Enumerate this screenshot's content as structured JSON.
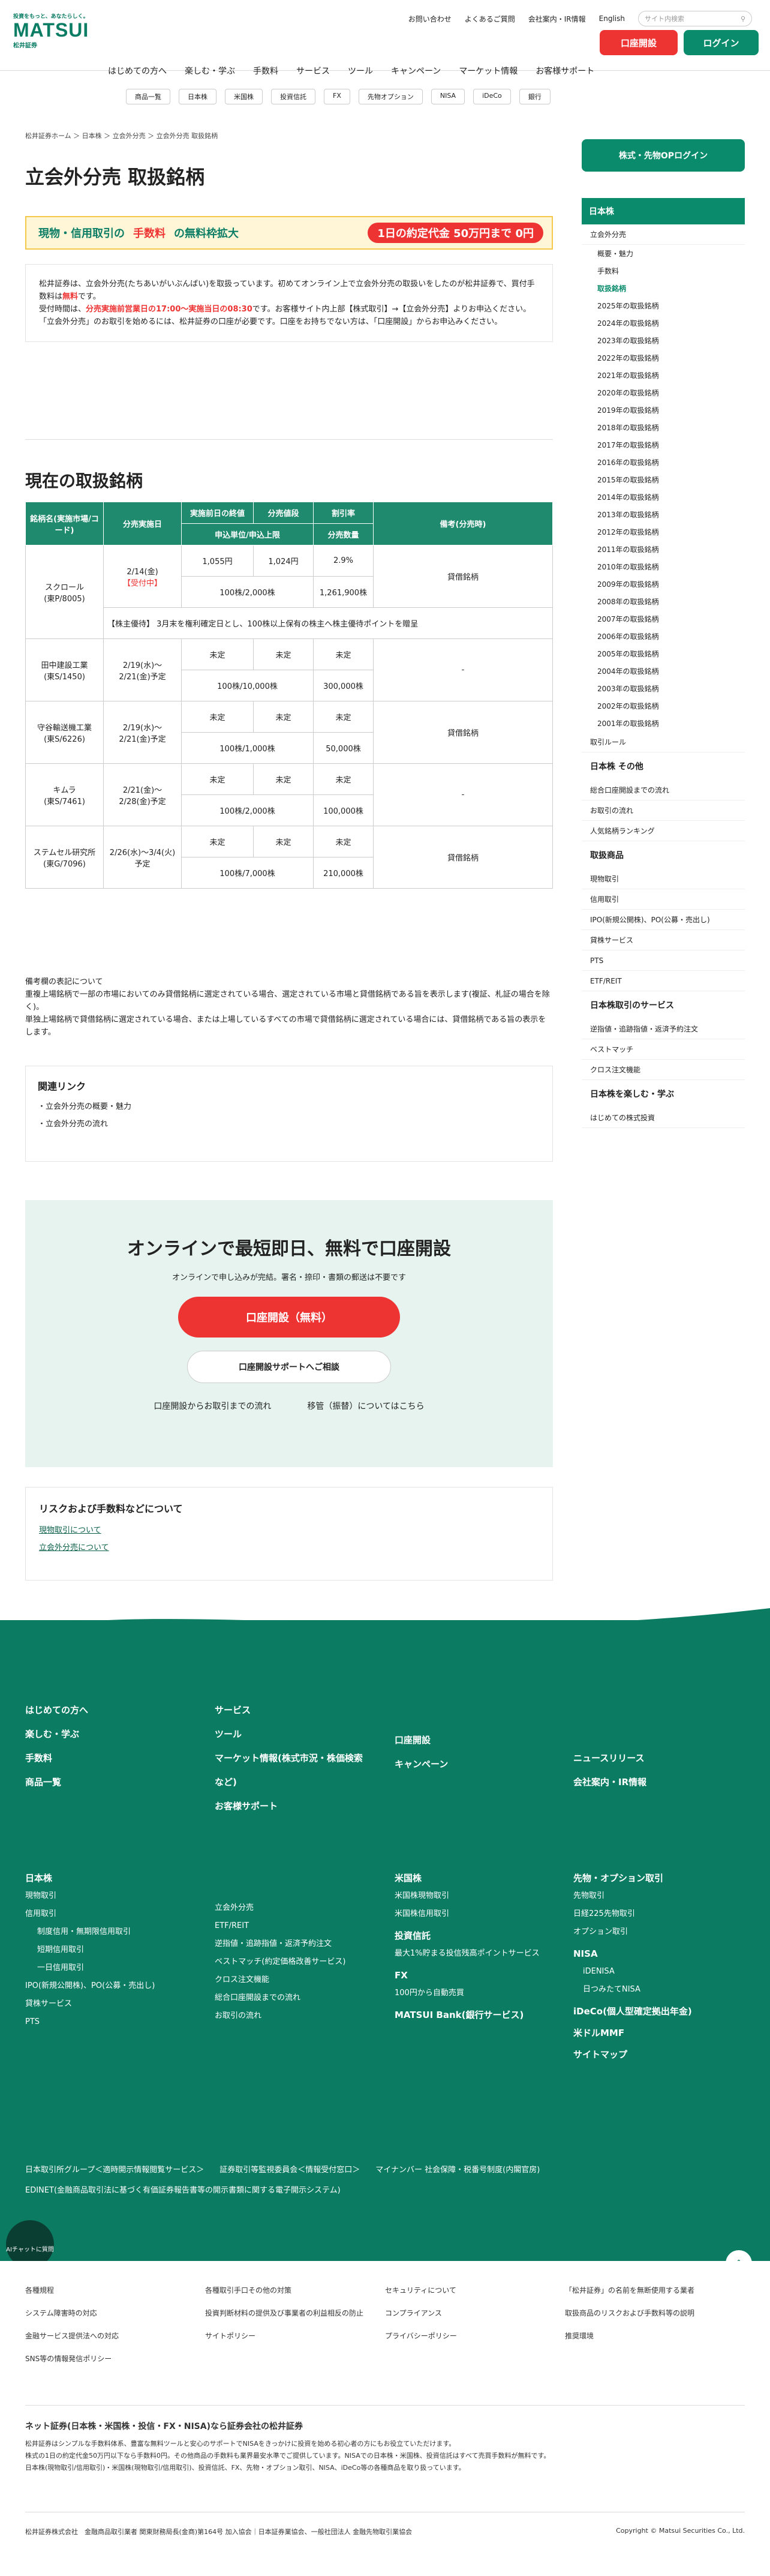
{
  "header": {
    "tagline": "投資をもっと、あなたらしく。",
    "logo": "MATSUI",
    "logo_sub": "松井証券",
    "links": [
      "お問い合わせ",
      "よくあるご質問",
      "会社案内・IR情報",
      "English"
    ],
    "search_placeholder": "サイト内検索",
    "open_account": "口座開設",
    "login": "ログイン"
  },
  "nav": {
    "items": [
      "はじめての方へ",
      "楽しむ・学ぶ",
      "手数料",
      "サービス",
      "ツール",
      "キャンペーン",
      "マーケット情報",
      "お客様サポート"
    ],
    "sub": [
      "商品一覧",
      "日本株",
      "米国株",
      "投資信託",
      "FX",
      "先物オプション",
      "NISA",
      "iDeCo",
      "銀行"
    ]
  },
  "breadcrumb": "松井証券ホーム ＞ 日本株 ＞ 立会外分売 ＞ 立会外分売 取扱銘柄",
  "page_title": "立会外分売 取扱銘柄",
  "banner": {
    "text1": "現物・信用取引の",
    "text2": "手数料",
    "text3": "の無料枠拡大",
    "text4": "1日の約定代金",
    "text5": "50万円まで",
    "text6": "0円"
  },
  "intro": {
    "p1": "松井証券は、立会外分売(たちあいがいぶんばい)を取扱っています。初めてオンライン上で立会外分売の取扱いをしたのが松井証券で、買付手数料は",
    "free": "無料",
    "p1b": "です。",
    "p2": "受付時間は、",
    "hours": "分売実施前営業日の17:00〜実施当日の08:30",
    "p2b": "です。お客様サイト内上部【株式取引】→【立会外分売】よりお申込ください。",
    "p3": "「立会外分売」のお取引を始めるには、松井証券の口座が必要です。口座をお持ちでない方は、「口座開設」からお申込みください。"
  },
  "section_title": "現在の取扱銘柄",
  "table": {
    "headers": [
      "銘柄名(実施市場/コード)",
      "分売実施日",
      "実施前日の終値",
      "分売値段",
      "割引率",
      "備考(分売時)"
    ],
    "sub_headers": [
      "申込単位/申込上限",
      "分売数量"
    ],
    "rows": [
      {
        "name": "スクロール",
        "code": "(東P/8005)",
        "date": "2/14(金)",
        "status": "【受付中】",
        "close": "1,055円",
        "price": "1,024円",
        "rate": "2.9%",
        "unit": "100株/2,000株",
        "qty": "1,261,900株",
        "note": "貸借銘柄",
        "extra": "【株主優待】 3月末を権利確定日とし、100株以上保有の株主へ株主優待ポイントを贈呈"
      },
      {
        "name": "田中建設工業",
        "code": "(東S/1450)",
        "date": "2/19(水)〜2/21(金)予定",
        "close": "未定",
        "price": "未定",
        "rate": "未定",
        "unit": "100株/10,000株",
        "qty": "300,000株",
        "note": "-"
      },
      {
        "name": "守谷輸送機工業",
        "code": "(東S/6226)",
        "date": "2/19(水)〜2/21(金)予定",
        "close": "未定",
        "price": "未定",
        "rate": "未定",
        "unit": "100株/1,000株",
        "qty": "50,000株",
        "note": "貸借銘柄"
      },
      {
        "name": "キムラ",
        "code": "(東S/7461)",
        "date": "2/21(金)〜2/28(金)予定",
        "close": "未定",
        "price": "未定",
        "rate": "未定",
        "unit": "100株/2,000株",
        "qty": "100,000株",
        "note": "-"
      },
      {
        "name": "ステムセル研究所",
        "code": "(東G/7096)",
        "date": "2/26(水)〜3/4(火)予定",
        "close": "未定",
        "price": "未定",
        "rate": "未定",
        "unit": "100株/7,000株",
        "qty": "210,000株",
        "note": "貸借銘柄"
      }
    ]
  },
  "notes": [
    "備考欄の表記について",
    "重複上場銘柄で一部の市場においてのみ貸借銘柄に選定されている場合、選定されている市場と貸借銘柄である旨を表示します(複証、札証の場合を除く)。",
    "単独上場銘柄で貸借銘柄に選定されている場合、または上場しているすべての市場で貸借銘柄に選定されている場合には、貸借銘柄である旨の表示をします。"
  ],
  "related": {
    "title": "関連リンク",
    "links": [
      "立会外分売の概要・魅力",
      "立会外分売の流れ"
    ]
  },
  "cta": {
    "title": "オンラインで最短即日、無料で口座開設",
    "desc": "オンラインで申し込みが完結。署名・捺印・書類の郵送は不要です",
    "primary": "口座開設（無料）",
    "secondary": "口座開設サポートへご相談",
    "link1": "口座開設からお取引までの流れ",
    "link2": "移管（振替）についてはこちら"
  },
  "risk": {
    "title": "リスクおよび手数料などについて",
    "links": [
      "現物取引について",
      "立会外分売について"
    ]
  },
  "sidebar": {
    "login": "株式・先物OPログイン",
    "head": "日本株",
    "items": [
      "立会外分売",
      "概要・魅力",
      "手数料",
      "取扱銘柄"
    ],
    "years": [
      "2025年の取扱銘柄",
      "2024年の取扱銘柄",
      "2023年の取扱銘柄",
      "2022年の取扱銘柄",
      "2021年の取扱銘柄",
      "2020年の取扱銘柄",
      "2019年の取扱銘柄",
      "2018年の取扱銘柄",
      "2017年の取扱銘柄",
      "2016年の取扱銘柄",
      "2015年の取扱銘柄",
      "2014年の取扱銘柄",
      "2013年の取扱銘柄",
      "2012年の取扱銘柄",
      "2011年の取扱銘柄",
      "2010年の取扱銘柄",
      "2009年の取扱銘柄",
      "2008年の取扱銘柄",
      "2007年の取扱銘柄",
      "2006年の取扱銘柄",
      "2005年の取扱銘柄",
      "2004年の取扱銘柄",
      "2003年の取扱銘柄",
      "2002年の取扱銘柄",
      "2001年の取扱銘柄"
    ],
    "rule": "取引ルール",
    "other_head": "日本株 その他",
    "other": [
      "総合口座開設までの流れ",
      "お取引の流れ",
      "人気銘柄ランキング"
    ],
    "products_head": "取扱商品",
    "products": [
      "現物取引",
      "信用取引",
      "IPO(新規公開株)、PO(公募・売出し)",
      "貸株サービス",
      "PTS",
      "ETF/REIT"
    ],
    "services_head": "日本株取引のサービス",
    "services": [
      "逆指値・追跡指値・返済予約注文",
      "ベストマッチ",
      "クロス注文機能"
    ],
    "fun_head": "日本株を楽しむ・学ぶ",
    "fun": [
      "はじめての株式投資"
    ]
  },
  "footer": {
    "col1": [
      "はじめての方へ",
      "楽しむ・学ぶ",
      "手数料",
      "商品一覧"
    ],
    "col2": [
      "サービス",
      "ツール",
      "マーケット情報(株式市況・株価検索など)",
      "お客様サポート"
    ],
    "col3": [
      "口座開設",
      "キャンペーン"
    ],
    "col4": [
      "ニュースリリース",
      "会社案内・IR情報"
    ],
    "jp_head": "日本株",
    "jp": [
      "現物取引",
      "信用取引",
      "制度信用・無期限信用取引",
      "短期信用取引",
      "一日信用取引",
      "IPO(新規公開株)、PO(公募・売出し)",
      "貸株サービス",
      "PTS"
    ],
    "jp2": [
      "立会外分売",
      "ETF/REIT",
      "逆指値・追跡指値・返済予約注文",
      "ベストマッチ(約定価格改善サービス)",
      "クロス注文機能",
      "総合口座開設までの流れ",
      "お取引の流れ"
    ],
    "us_head": "米国株",
    "us": [
      "米国株現物取引",
      "米国株信用取引"
    ],
    "fund_head": "投資信託",
    "fund": [
      "最大1%貯まる投信残高ポイントサービス"
    ],
    "fx_head": "FX",
    "fx": [
      "100円から自動売買"
    ],
    "bank": "MATSUI Bank(銀行サービス)",
    "fut_head": "先物・オプション取引",
    "fut": [
      "先物取引",
      "日経225先物取引",
      "オプション取引"
    ],
    "nisa_head": "NISA",
    "nisa": [
      "iDENISA",
      "日つみたてNISA"
    ],
    "ideco": "iDeCo(個人型確定拠出年金)",
    "mmf": "米ドルMMF",
    "sitemap": "サイトマップ",
    "links": [
      "日本取引所グループ＜適時開示情報閲覧サービス＞",
      "証券取引等監視委員会＜情報受付窓口＞",
      "マイナンバー 社会保障・税番号制度(内閣官房)",
      "EDINET(金融商品取引法に基づく有価証券報告書等の開示書類に関する電子開示システム)"
    ],
    "policy": [
      "各種規程",
      "システム障害時の対応",
      "金融サービス提供法への対応",
      "SNS等の情報発信ポリシー",
      "各種取引手口その他の対策",
      "投資判断材料の提供及び事業者の利益相反の防止",
      "サイトポリシー",
      "セキュリティについて",
      "コンプライアンス",
      "プライバシーポリシー",
      "「松井証券」の名前を無断使用する業者",
      "取扱商品のリスクおよび手数料等の説明",
      "推奨環境"
    ],
    "chat": "AIチャットに質問",
    "slogan": "ネット証券(日本株・米国株・投信・FX・NISA)なら証券会社の松井証券",
    "disclaimer": [
      "松井証券はシンプルな手数料体系、豊富な無料ツールと安心のサポートでNISAをきっかけに投資を始める初心者の方にもお役立ていただけます。",
      "株式の1日の約定代金50万円以下なら手数料0円。その他商品の手数料も業界最安水準でご提供しています。NISAでの日本株・米国株、投資信託はすべて売買手数料が無料です。",
      "日本株(現物取引/信用取引)・米国株(現物取引/信用取引)、投資信託、FX、先物・オプション取引、NISA、iDeCo等の各種商品を取り扱っています。"
    ],
    "company": "松井証券株式会社　金融商品取引業者 関東財務局長(金商)第164号 加入協会｜日本証券業協会、一般社団法人 金融先物取引業協会",
    "copyright": "Copyright © Matsui Securities Co., Ltd."
  }
}
